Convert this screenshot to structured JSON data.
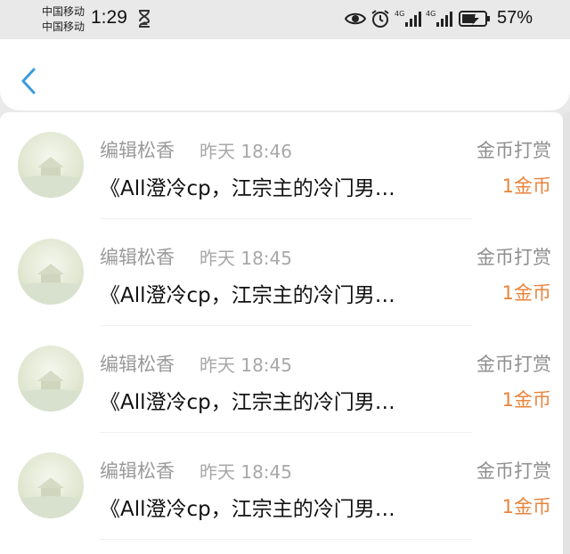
{
  "status_bar": {
    "carrier_1": "中国移动",
    "carrier_2": "中国移动",
    "time": "1:29",
    "battery": "57%",
    "icons": [
      "hourglass-icon",
      "eye-icon",
      "alarm-icon",
      "signal-4g-icon",
      "signal-4g-icon",
      "battery-charging-icon"
    ]
  },
  "header": {
    "back_icon": "chevron-left-icon",
    "accent_color": "#3a9bdc"
  },
  "records": [
    {
      "name": "编辑松香",
      "time": "昨天 18:46",
      "action": "金币打赏",
      "title": "《All澄冷cp，江宗主的冷门男…",
      "amount": "1金币"
    },
    {
      "name": "编辑松香",
      "time": "昨天 18:45",
      "action": "金币打赏",
      "title": "《All澄冷cp，江宗主的冷门男…",
      "amount": "1金币"
    },
    {
      "name": "编辑松香",
      "time": "昨天 18:45",
      "action": "金币打赏",
      "title": "《All澄冷cp，江宗主的冷门男…",
      "amount": "1金币"
    },
    {
      "name": "编辑松香",
      "time": "昨天 18:45",
      "action": "金币打赏",
      "title": "《All澄冷cp，江宗主的冷门男…",
      "amount": "1金币"
    }
  ],
  "colors": {
    "amount": "#e9843c",
    "background": "#e9e9e9"
  }
}
